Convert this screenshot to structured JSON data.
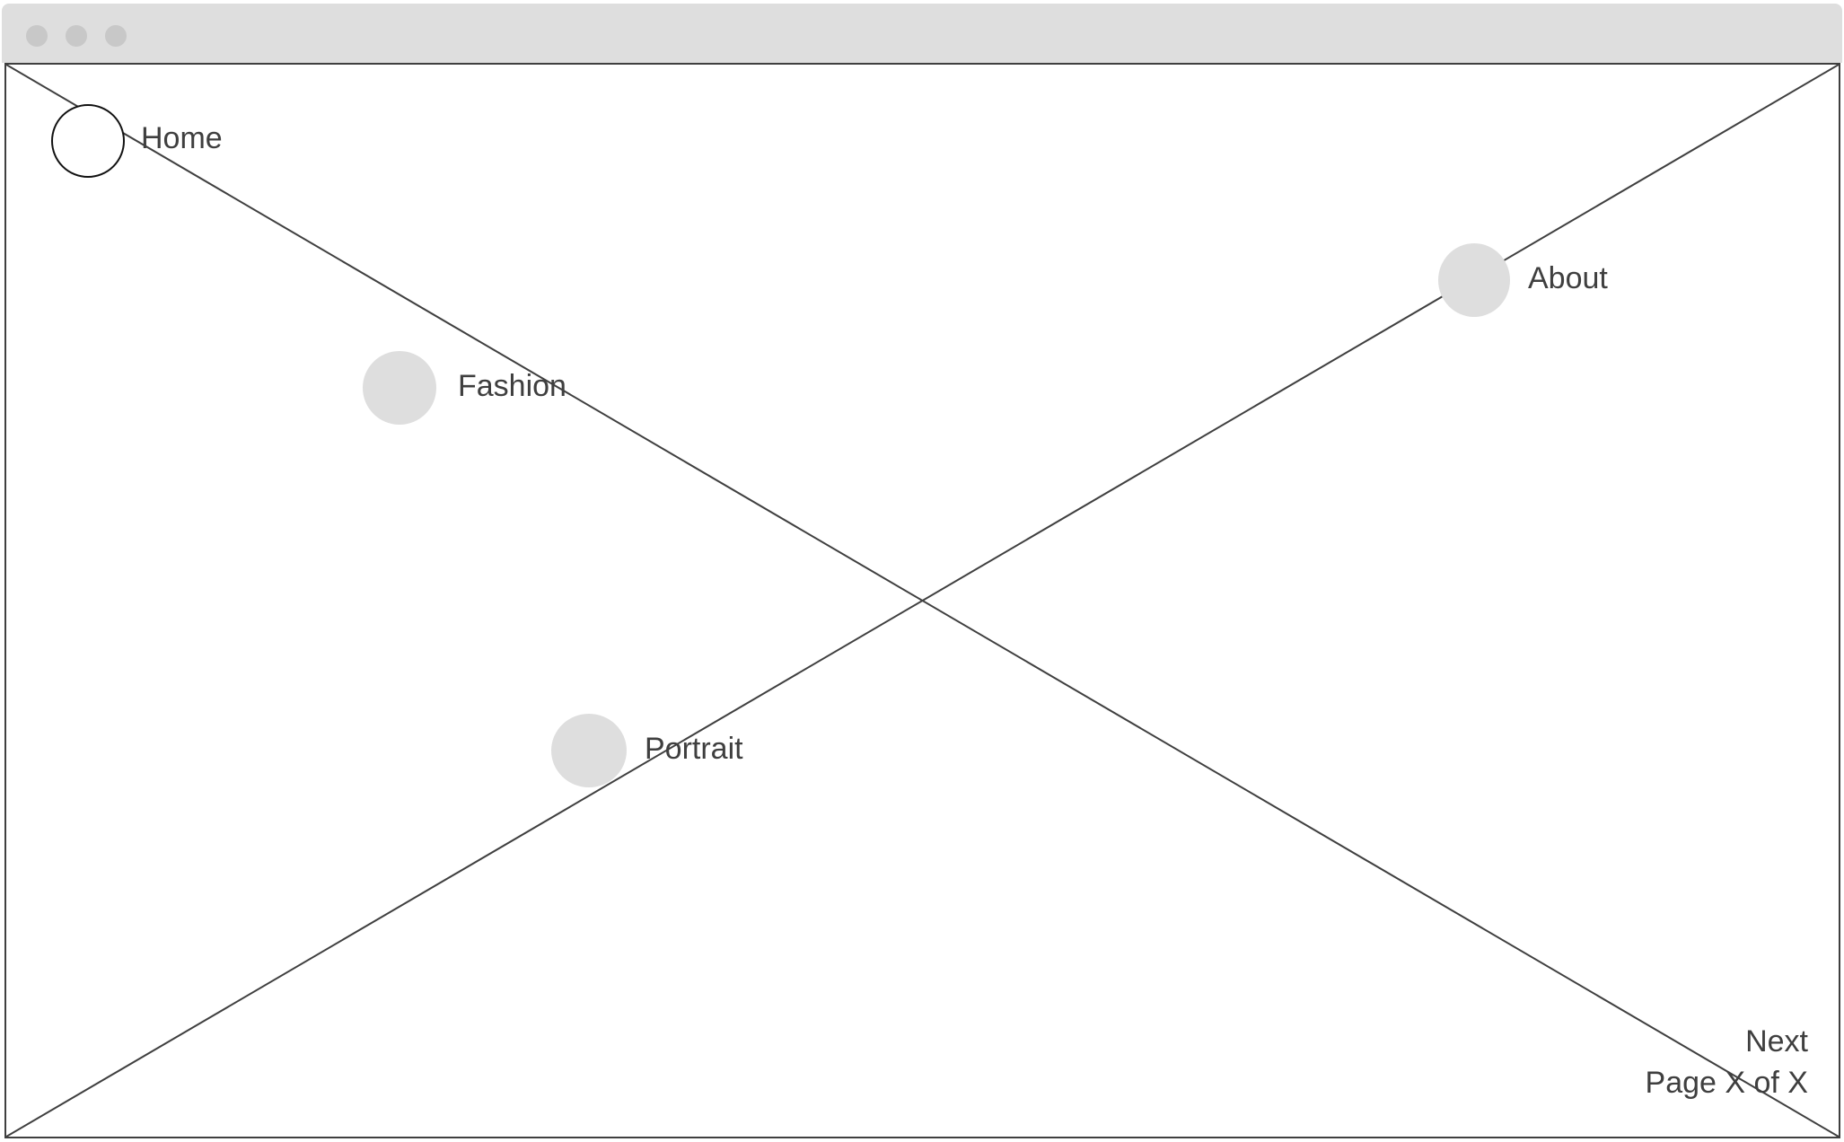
{
  "window": {
    "controls": [
      "close-dot",
      "minimize-dot",
      "maximize-dot"
    ]
  },
  "nav": {
    "items": [
      {
        "label": "Home",
        "active": true
      },
      {
        "label": "About",
        "active": false
      },
      {
        "label": "Fashion",
        "active": false
      },
      {
        "label": "Portrait",
        "active": false
      }
    ]
  },
  "pager": {
    "next_label": "Next",
    "page_label": "Page X of X"
  },
  "colors": {
    "chrome": "#dedede",
    "text": "#3f3f3f",
    "border": "#3f3f3f",
    "inactive_circle": "#dedede"
  }
}
